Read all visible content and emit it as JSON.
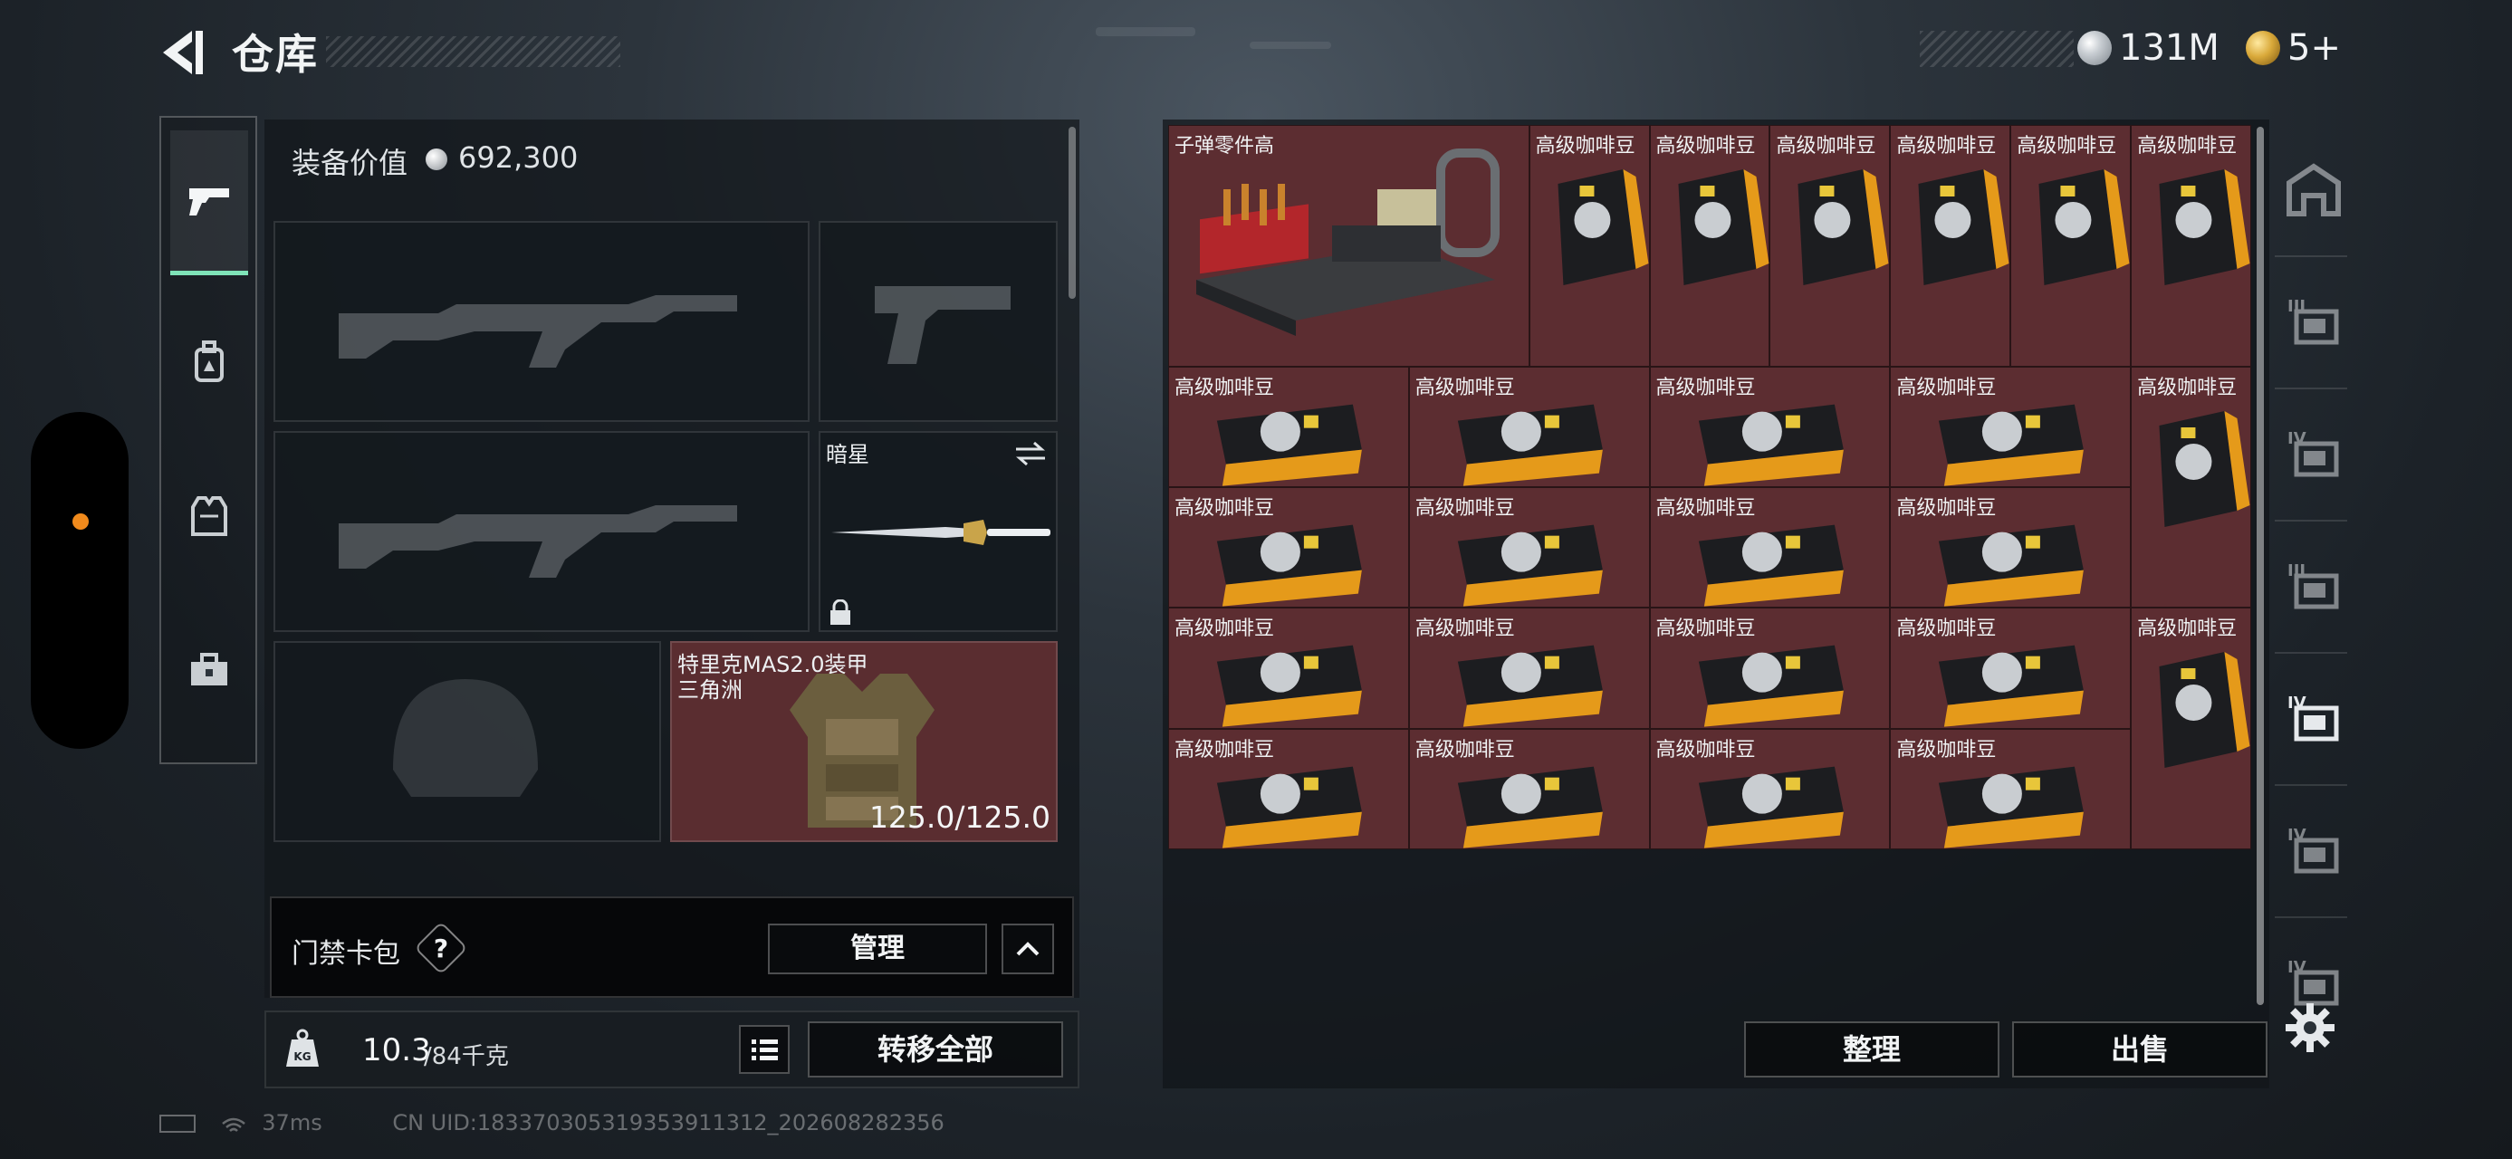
{
  "header": {
    "title": "仓库",
    "currency": [
      {
        "icon": "silver-coin-icon",
        "value": "131M"
      },
      {
        "icon": "gold-coin-icon",
        "value": "5+"
      }
    ]
  },
  "categories": [
    {
      "name": "pistol-icon",
      "active": true
    },
    {
      "name": "backpack-icon",
      "active": false
    },
    {
      "name": "vest-icon",
      "active": false
    },
    {
      "name": "toolbox-icon",
      "active": false
    }
  ],
  "equipment": {
    "value_label": "装备价值",
    "value": "692,300",
    "melee": {
      "name": "暗星"
    },
    "armor": {
      "name": "特里克MAS2.0装甲",
      "subtitle": "三角洲",
      "durability": "125.0/125.0"
    }
  },
  "keycard": {
    "label": "门禁卡包",
    "help": "?",
    "manage_label": "管理"
  },
  "weight": {
    "current": "10.3",
    "max": "/84千克",
    "transfer_label": "转移全部"
  },
  "status": {
    "ping": "37ms",
    "uid": "CN UID:183370305319353911312_202608282356"
  },
  "storage": {
    "items": [
      {
        "name": "子弹零件高",
        "kind": "ammo-parts"
      },
      {
        "name": "高级咖啡豆",
        "kind": "coffee-tall"
      },
      {
        "name": "高级咖啡豆",
        "kind": "coffee-tall"
      },
      {
        "name": "高级咖啡豆",
        "kind": "coffee-tall"
      },
      {
        "name": "高级咖啡豆",
        "kind": "coffee-tall"
      },
      {
        "name": "高级咖啡豆",
        "kind": "coffee-tall"
      },
      {
        "name": "高级咖啡豆",
        "kind": "coffee-tall"
      },
      {
        "name": "高级咖啡豆",
        "kind": "coffee-wide"
      },
      {
        "name": "高级咖啡豆",
        "kind": "coffee-wide"
      },
      {
        "name": "高级咖啡豆",
        "kind": "coffee-wide"
      },
      {
        "name": "高级咖啡豆",
        "kind": "coffee-wide"
      },
      {
        "name": "高级咖啡豆",
        "kind": "coffee-tall"
      },
      {
        "name": "高级咖啡豆",
        "kind": "coffee-wide"
      },
      {
        "name": "高级咖啡豆",
        "kind": "coffee-wide"
      },
      {
        "name": "高级咖啡豆",
        "kind": "coffee-wide"
      },
      {
        "name": "高级咖啡豆",
        "kind": "coffee-wide"
      },
      {
        "name": "高级咖啡豆",
        "kind": "coffee-wide"
      },
      {
        "name": "高级咖啡豆",
        "kind": "coffee-wide"
      },
      {
        "name": "高级咖啡豆",
        "kind": "coffee-wide"
      },
      {
        "name": "高级咖啡豆",
        "kind": "coffee-wide"
      },
      {
        "name": "高级咖啡豆",
        "kind": "coffee-tall"
      },
      {
        "name": "高级咖啡豆",
        "kind": "coffee-wide"
      },
      {
        "name": "高级咖啡豆",
        "kind": "coffee-wide"
      },
      {
        "name": "高级咖啡豆",
        "kind": "coffee-wide"
      },
      {
        "name": "高级咖啡豆",
        "kind": "coffee-wide"
      }
    ],
    "sort_label": "整理",
    "sell_label": "出售"
  },
  "right_rail": [
    {
      "name": "storage-main-icon",
      "badge": ""
    },
    {
      "name": "storage-tier-3-a-icon",
      "badge": "III"
    },
    {
      "name": "storage-tier-4-a-icon",
      "badge": "IV"
    },
    {
      "name": "storage-tier-3-b-icon",
      "badge": "III"
    },
    {
      "name": "storage-tier-4-b-icon",
      "badge": "IV",
      "active": true
    },
    {
      "name": "storage-tier-4-c-icon",
      "badge": "IV"
    },
    {
      "name": "storage-tier-4-d-icon",
      "badge": "IV"
    }
  ]
}
